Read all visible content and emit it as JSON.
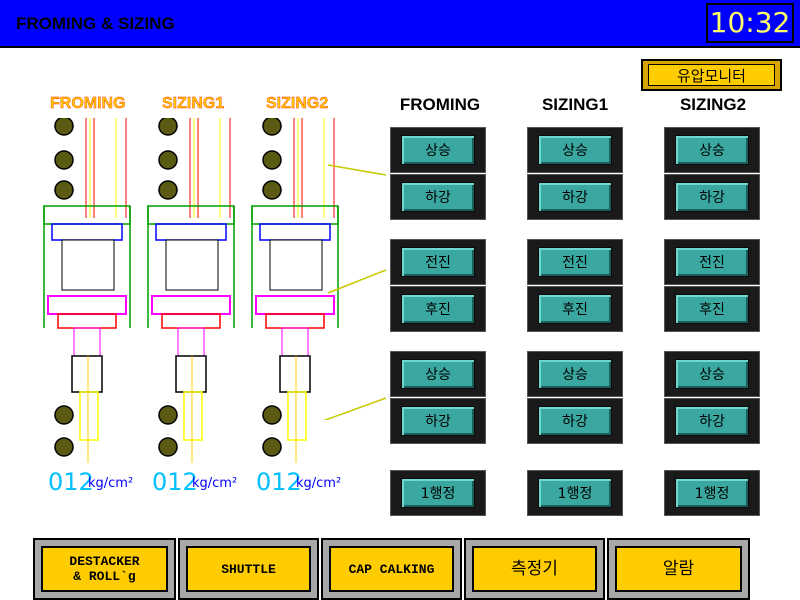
{
  "header": {
    "title": "FROMING & SIZING",
    "clock": "10:32"
  },
  "monitor_button": {
    "label": "유압모니터"
  },
  "diagram": {
    "labels": [
      "FROMING",
      "SIZING1",
      "SIZING2"
    ],
    "pressures": [
      {
        "value": "012",
        "unit": "kg/cm²"
      },
      {
        "value": "012",
        "unit": "kg/cm²"
      },
      {
        "value": "012",
        "unit": "kg/cm²"
      }
    ]
  },
  "columns": [
    {
      "header": "FROMING",
      "buttons": [
        "상승",
        "하강",
        "전진",
        "후진",
        "상승",
        "하강",
        "1행정"
      ]
    },
    {
      "header": "SIZING1",
      "buttons": [
        "상승",
        "하강",
        "전진",
        "후진",
        "상승",
        "하강",
        "1행정"
      ]
    },
    {
      "header": "SIZING2",
      "buttons": [
        "상승",
        "하강",
        "전진",
        "후진",
        "상승",
        "하강",
        "1행정"
      ]
    }
  ],
  "bottom_nav": [
    {
      "label": "DESTACKER\n& ROLL`g"
    },
    {
      "label": "SHUTTLE"
    },
    {
      "label": "CAP CALKING"
    },
    {
      "label": "측정기"
    },
    {
      "label": "알람"
    }
  ],
  "colors": {
    "header_bg": "#0000ff",
    "button_face": "#3aa8a0",
    "nav_button": "#ffcc00",
    "pressure_value": "#00c0ff"
  }
}
